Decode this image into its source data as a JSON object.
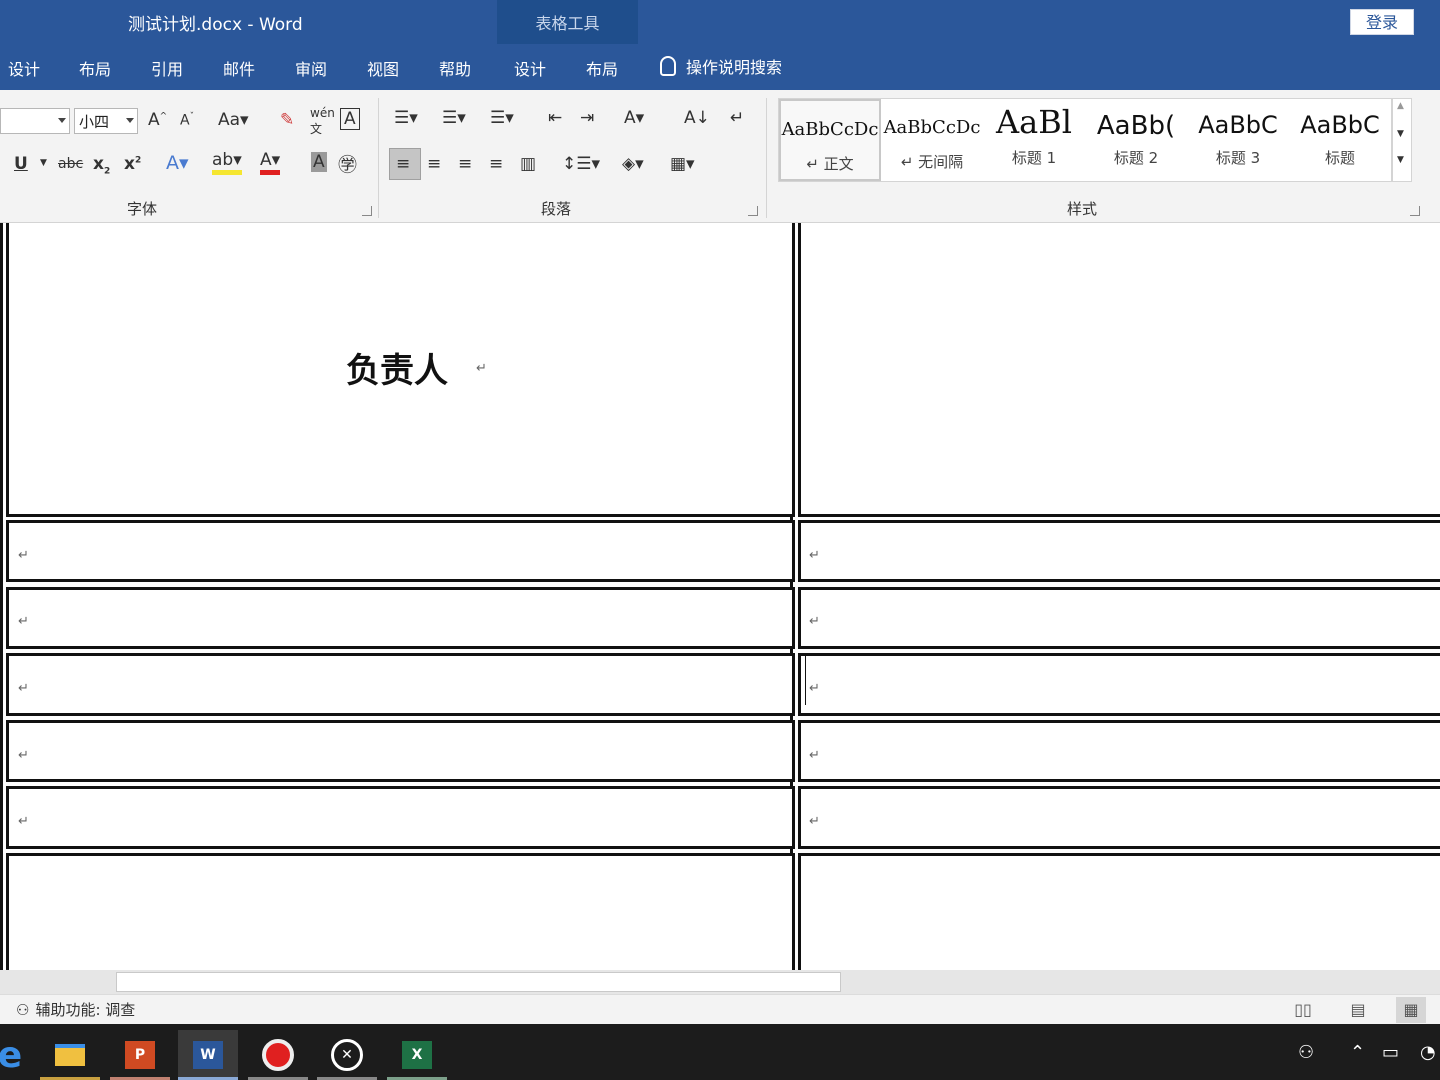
{
  "window": {
    "title": "测试计划.docx  -  Word",
    "context_tab": "表格工具",
    "login": "登录"
  },
  "tabs": [
    "设计",
    "布局",
    "引用",
    "邮件",
    "审阅",
    "视图",
    "帮助",
    "设计",
    "布局"
  ],
  "tell_me": "操作说明搜索",
  "ribbon": {
    "font_size": "小四",
    "groups": {
      "font": "字体",
      "paragraph": "段落",
      "styles": "样式"
    }
  },
  "styles": [
    {
      "sample": "AaBbCcDc",
      "name": "↵ 正文"
    },
    {
      "sample": "AaBbCcDc",
      "name": "↵ 无间隔"
    },
    {
      "sample": "AaBl",
      "name": "标题 1"
    },
    {
      "sample": "AaBb(",
      "name": "标题 2"
    },
    {
      "sample": "AaBbC",
      "name": "标题 3"
    },
    {
      "sample": "AaBbC",
      "name": "标题"
    }
  ],
  "document": {
    "header_text": "负责人",
    "para_mark": "↵"
  },
  "status": {
    "accessibility": "辅助功能: 调查"
  },
  "colors": {
    "brand": "#2b579a",
    "ribbon_bg": "#f3f3f3",
    "taskbar": "#1c1c1c"
  }
}
